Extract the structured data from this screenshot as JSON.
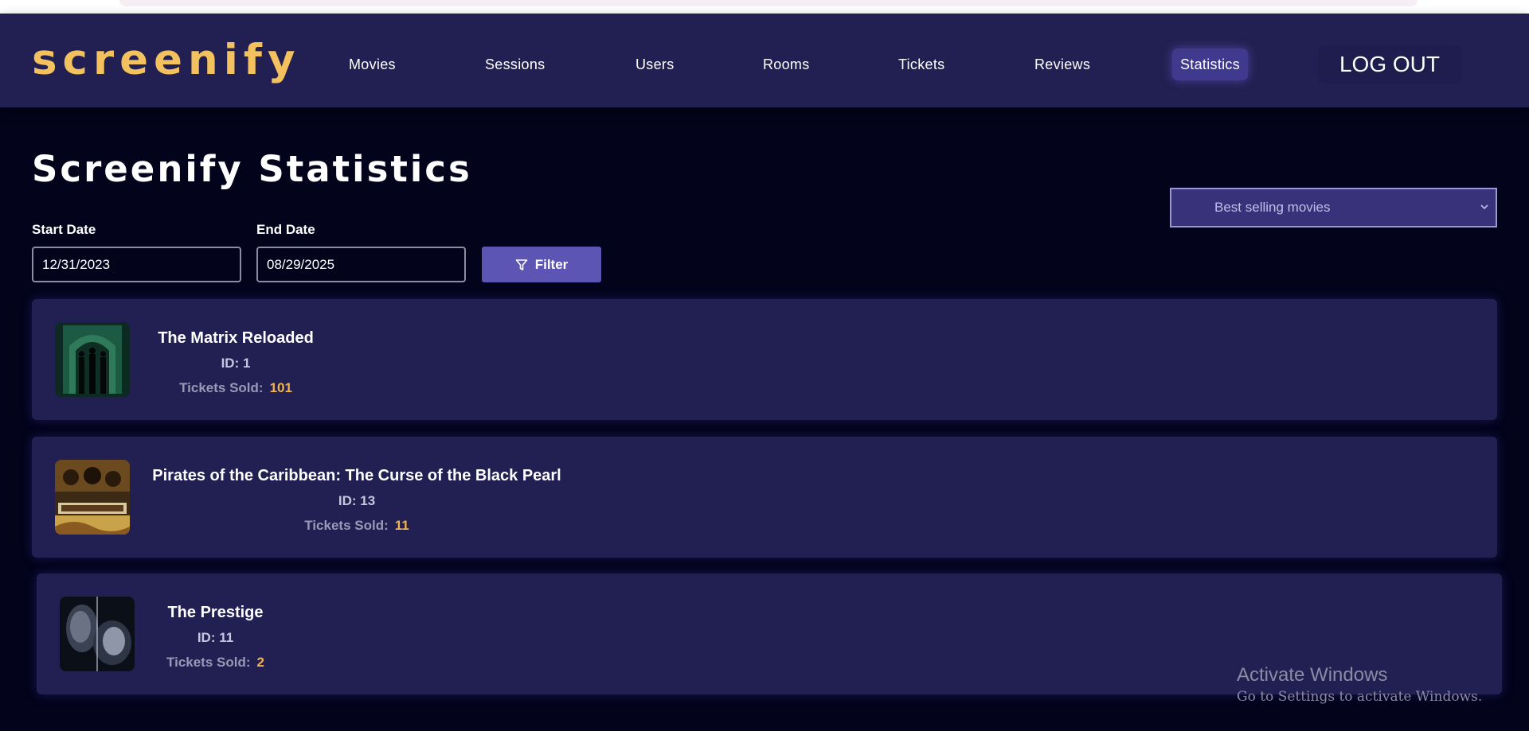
{
  "colors": {
    "page_bg": "#03031c",
    "nav_bg": "#222052",
    "logo": "#f3c25e",
    "accent": "#5d55b4",
    "card_bg": "#222052",
    "tickets_value": "#f3b24d"
  },
  "header": {
    "logo": "screenify",
    "nav": [
      {
        "label": "Movies"
      },
      {
        "label": "Sessions"
      },
      {
        "label": "Users"
      },
      {
        "label": "Rooms"
      },
      {
        "label": "Tickets"
      },
      {
        "label": "Reviews"
      },
      {
        "label": "Statistics",
        "active": true
      }
    ],
    "logout_label": "LOG OUT"
  },
  "main": {
    "title": "Screenify Statistics",
    "statistic_select": {
      "selected": "Best selling movies",
      "icon": "chevron-down-icon"
    },
    "start_date": {
      "label": "Start Date",
      "value": "12/31/2023"
    },
    "end_date": {
      "label": "End Date",
      "value": "08/29/2025"
    },
    "filter_button": {
      "label": "Filter",
      "icon": "filter-icon"
    },
    "id_prefix": "ID: ",
    "tickets_label": "Tickets Sold:",
    "movies": [
      {
        "title": "The Matrix Reloaded",
        "id": "1",
        "tickets_sold": "101"
      },
      {
        "title": "Pirates of the Caribbean: The Curse of the Black Pearl",
        "id": "13",
        "tickets_sold": "11"
      },
      {
        "title": "The Prestige",
        "id": "11",
        "tickets_sold": "2"
      }
    ]
  },
  "watermark": {
    "title": "Activate Windows",
    "subtitle": "Go to Settings to activate Windows."
  }
}
